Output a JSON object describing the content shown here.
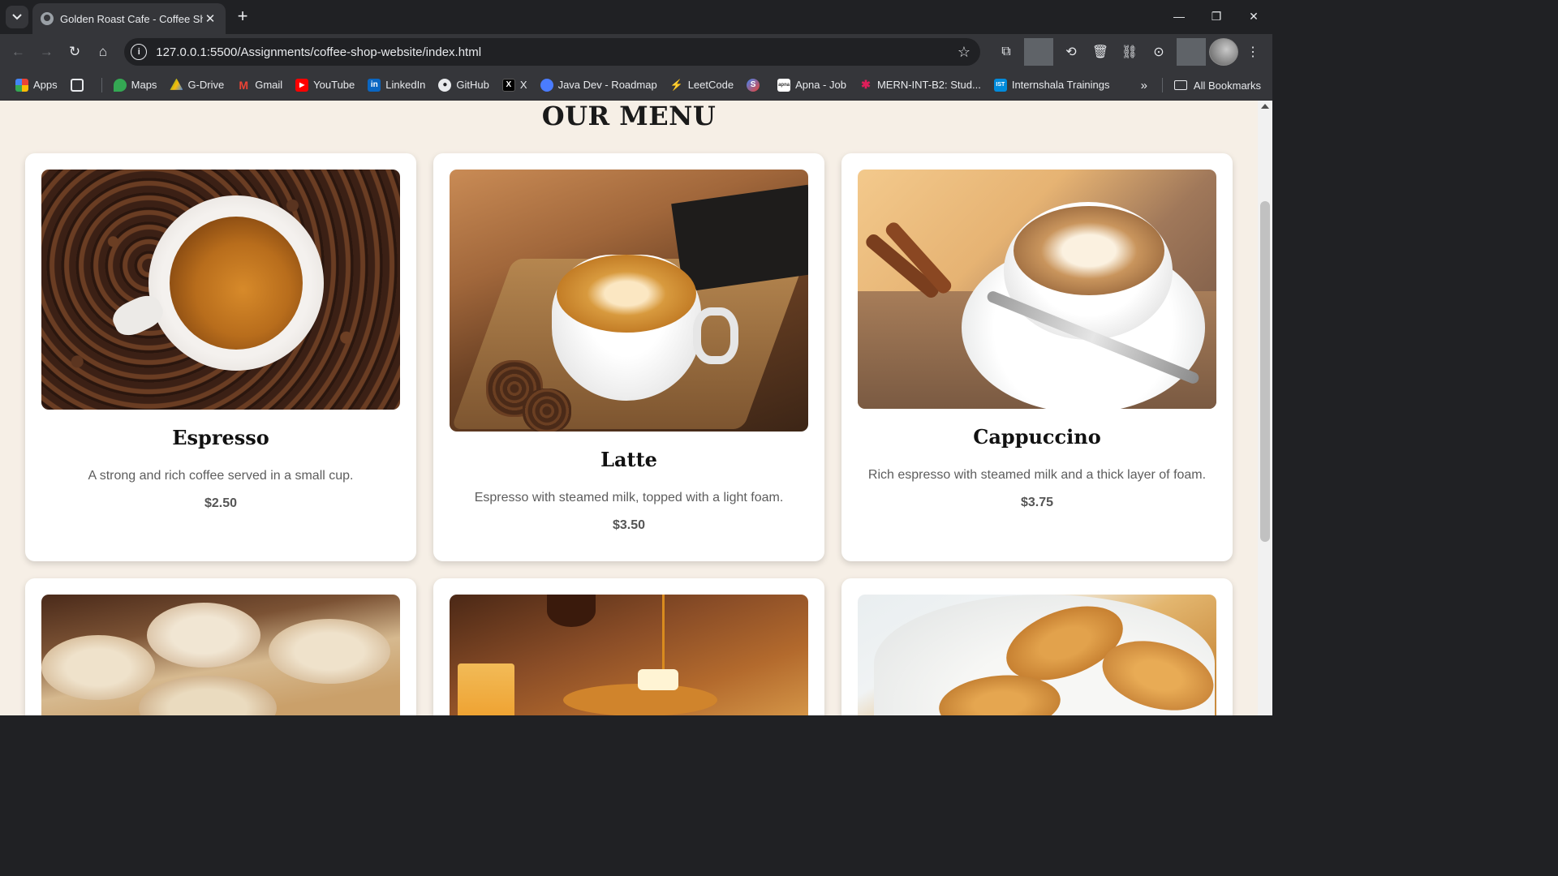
{
  "browser": {
    "tab_title": "Golden Roast Cafe - Coffee Shop",
    "url": "127.0.0.1:5500/Assignments/coffee-shop-website/index.html",
    "bookmarks": [
      {
        "label": "Apps",
        "icon": "apps-grid-icon",
        "color": "#ea4335"
      },
      {
        "label": "Maps",
        "icon": "maps-pin-icon",
        "color": "#34a853"
      },
      {
        "label": "G-Drive",
        "icon": "drive-icon",
        "color": "#fbbc04"
      },
      {
        "label": "Gmail",
        "icon": "gmail-icon",
        "color": "#ea4335"
      },
      {
        "label": "YouTube",
        "icon": "youtube-icon",
        "color": "#ff0000"
      },
      {
        "label": "LinkedIn",
        "icon": "linkedin-icon",
        "color": "#0a66c2"
      },
      {
        "label": "GitHub",
        "icon": "github-icon",
        "color": "#ffffff"
      },
      {
        "label": "X",
        "icon": "x-icon",
        "color": "#000000"
      },
      {
        "label": "Java Dev - Roadmap",
        "icon": "chat-bubble-icon",
        "color": "#4a7cff"
      },
      {
        "label": "LeetCode",
        "icon": "leetcode-icon",
        "color": "#ffa116"
      },
      {
        "label": "Apna - Job",
        "icon": "apna-icon",
        "color": "#ffffff"
      },
      {
        "label": "MERN-INT-B2: Stud...",
        "icon": "slack-icon",
        "color": "#e01e5a"
      },
      {
        "label": "Internshala Trainings",
        "icon": "ist-icon",
        "color": "#008bdc"
      }
    ],
    "all_bookmarks_label": "All Bookmarks"
  },
  "page": {
    "menu_title": "OUR MENU",
    "items": [
      {
        "name": "Espresso",
        "description": "A strong and rich coffee served in a small cup.",
        "price": "$2.50"
      },
      {
        "name": "Latte",
        "description": "Espresso with steamed milk, topped with a light foam.",
        "price": "$3.50"
      },
      {
        "name": "Cappuccino",
        "description": "Rich espresso with steamed milk and a thick layer of foam.",
        "price": "$3.75"
      }
    ],
    "colors": {
      "background": "#f6efe6",
      "card": "#ffffff",
      "title": "#1a1a1a",
      "text": "#5d5d5d"
    }
  }
}
